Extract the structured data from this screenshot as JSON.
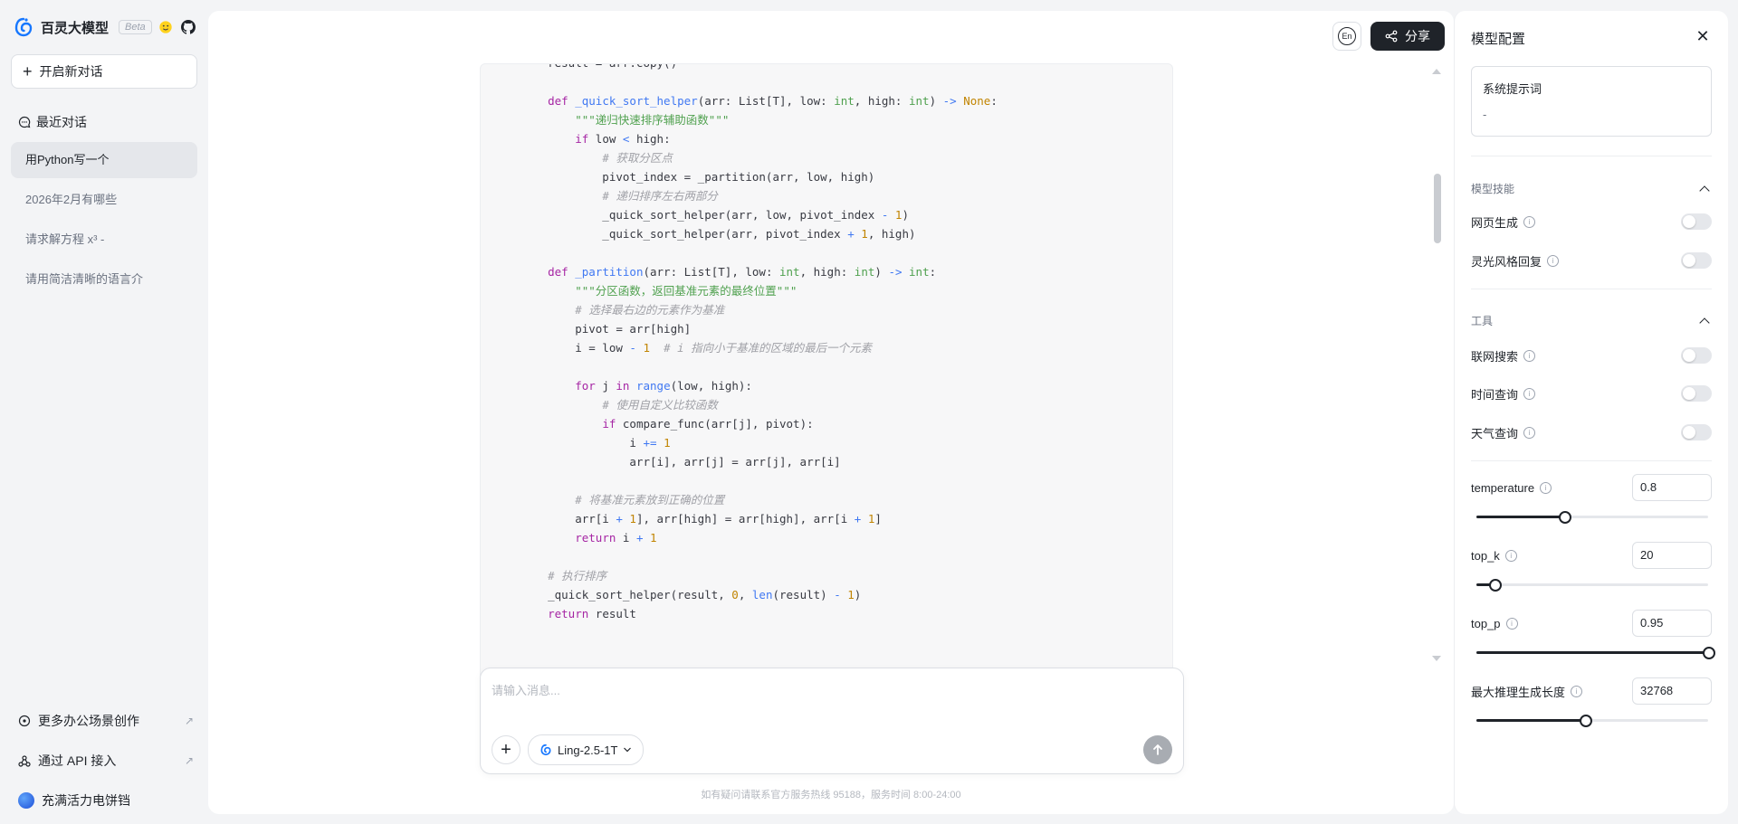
{
  "brand": {
    "name": "百灵大模型",
    "beta": "Beta"
  },
  "sidebar": {
    "new_chat": "开启新对话",
    "recent_label": "最近对话",
    "history": [
      {
        "label": "用Python写一个",
        "active": true
      },
      {
        "label": "2026年2月有哪些",
        "active": false
      },
      {
        "label": "请求解方程 x³ -",
        "active": false
      },
      {
        "label": "请用简洁清晰的语言介",
        "active": false
      }
    ],
    "bottom": {
      "office": "更多办公场景创作",
      "api": "通过 API 接入",
      "user": "充满活力电饼铛"
    }
  },
  "header": {
    "lang": "En",
    "share": "分享"
  },
  "code_lines": [
    "    result = arr.copy()",
    "",
    "    def _quick_sort_helper(arr: List[T], low: int, high: int) -> None:",
    "        \"\"\"递归快速排序辅助函数\"\"\"",
    "        if low < high:",
    "            # 获取分区点",
    "            pivot_index = _partition(arr, low, high)",
    "            # 递归排序左右两部分",
    "            _quick_sort_helper(arr, low, pivot_index - 1)",
    "            _quick_sort_helper(arr, pivot_index + 1, high)",
    "",
    "    def _partition(arr: List[T], low: int, high: int) -> int:",
    "        \"\"\"分区函数，返回基准元素的最终位置\"\"\"",
    "        # 选择最右边的元素作为基准",
    "        pivot = arr[high]",
    "        i = low - 1  # i 指向小于基准的区域的最后一个元素",
    "",
    "        for j in range(low, high):",
    "            # 使用自定义比较函数",
    "            if compare_func(arr[j], pivot):",
    "                i += 1",
    "                arr[i], arr[j] = arr[j], arr[i]",
    "",
    "        # 将基准元素放到正确的位置",
    "        arr[i + 1], arr[high] = arr[high], arr[i + 1]",
    "        return i + 1",
    "",
    "    # 执行排序",
    "    _quick_sort_helper(result, 0, len(result) - 1)",
    "    return result"
  ],
  "composer": {
    "placeholder": "请输入消息...",
    "model": "Ling-2.5-1T"
  },
  "footer": "如有疑问请联系官方服务热线 95188，服务时间 8:00-24:00",
  "config": {
    "title": "模型配置",
    "system_prompt": {
      "label": "系统提示词",
      "value": "-"
    },
    "skills": {
      "title": "模型技能",
      "items": [
        {
          "label": "网页生成",
          "on": false
        },
        {
          "label": "灵光风格回复",
          "on": false
        }
      ]
    },
    "tools": {
      "title": "工具",
      "items": [
        {
          "label": "联网搜索",
          "on": false
        },
        {
          "label": "时间查询",
          "on": false
        },
        {
          "label": "天气查询",
          "on": false
        }
      ]
    },
    "params": [
      {
        "label": "temperature",
        "value": "0.8",
        "fraction": 0.38
      },
      {
        "label": "top_k",
        "value": "20",
        "fraction": 0.08
      },
      {
        "label": "top_p",
        "value": "0.95",
        "fraction": 1.0
      },
      {
        "label": "最大推理生成长度",
        "value": "32768",
        "fraction": 0.47
      }
    ]
  },
  "colors": {
    "accent": "#1f2329",
    "brand_blue": "#1677ff"
  }
}
